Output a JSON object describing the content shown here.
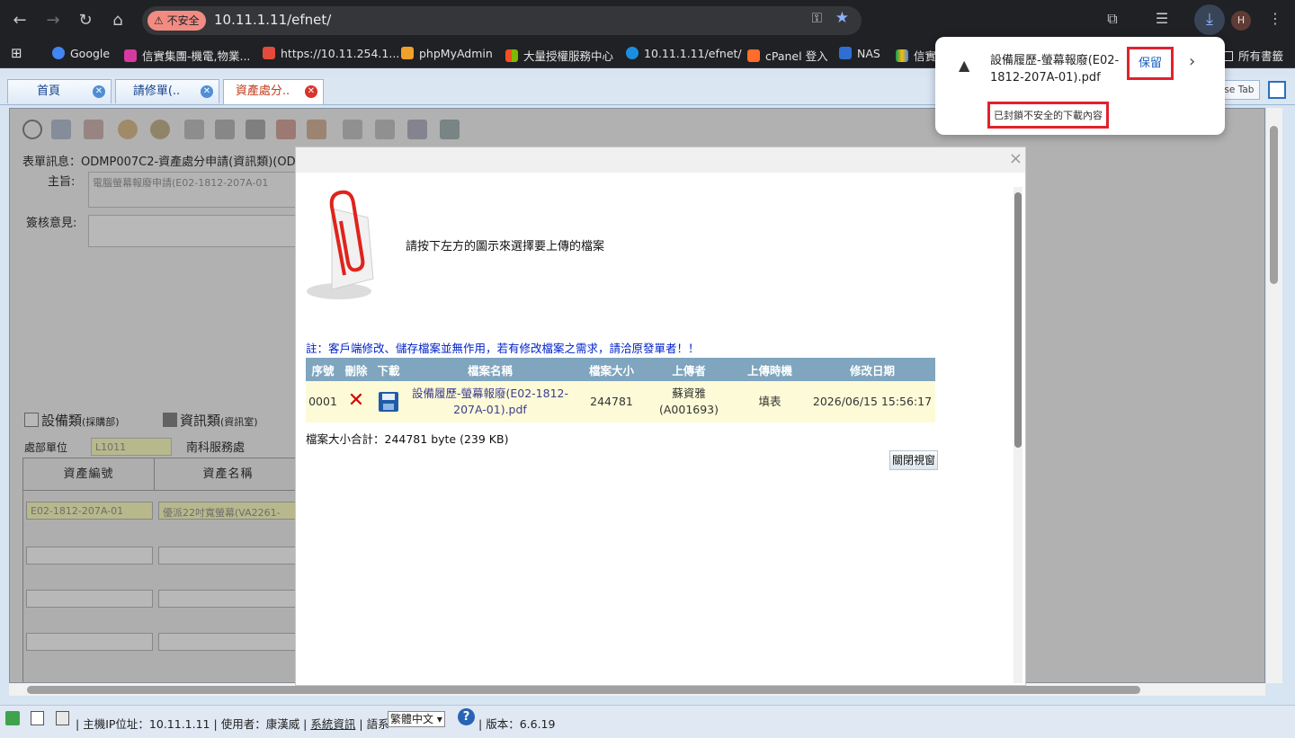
{
  "browser": {
    "insecure_label": "不安全",
    "url": "10.11.1.11/efnet/",
    "avatar_letter": "H",
    "bookmarks": [
      "Google",
      "信實集團-機電,物業...",
      "https://10.11.254.1...",
      "phpMyAdmin",
      "大量授權服務中心",
      "10.11.1.11/efnet/",
      "cPanel 登入",
      "NAS",
      "信實"
    ],
    "all_bookmarks": "所有書籤"
  },
  "download_popup": {
    "file_name": "設備履歷-螢幕報廢(E02-1812-207A-01).pdf",
    "status": "已封鎖不安全的下載內容",
    "keep_label": "保留"
  },
  "tabs": [
    {
      "label": "首頁",
      "active": false
    },
    {
      "label": "請修單(..",
      "active": false
    },
    {
      "label": "資產處分..",
      "active": true
    }
  ],
  "close_tab_label": "ose Tab",
  "form": {
    "info_label": "表單訊息：",
    "info_value": "ODMP007C2-資產處分申請(資訊類)(OD",
    "subject_label": "主旨:",
    "subject_value": "電腦螢幕報廢申請(E02-1812-207A-01",
    "review_label": "簽核意見:",
    "category_equipment": "設備類",
    "category_equipment_sub": "(採購部)",
    "category_it": "資訊類",
    "category_it_sub": "(資訊室)",
    "dept_label": "處部單位",
    "dept_code": "L1011",
    "dept_name": "南科服務處",
    "grid_headers": [
      "資產編號",
      "資產名稱"
    ],
    "grid_row1": [
      "E02-1812-207A-01",
      "優派22吋寬螢幕(VA2261-"
    ]
  },
  "dialog": {
    "prompt": "請按下左方的圖示來選擇要上傳的檔案",
    "note": "註：客戶端修改、儲存檔案並無作用，若有修改檔案之需求，請洽原發單者！！",
    "columns": [
      "序號",
      "刪除",
      "下載",
      "檔案名稱",
      "檔案大小",
      "上傳者",
      "上傳時機",
      "修改日期"
    ],
    "rows": [
      {
        "seq": "0001",
        "file_name": "設備履歷-螢幕報廢(E02-1812-207A-01).pdf",
        "size": "244781",
        "uploader": "蘇資雅(A001693)",
        "timing": "填表",
        "modified": "2026/06/15 15:56:17"
      }
    ],
    "total": "檔案大小合計：244781 byte (239 KB)",
    "close_button": "關閉視窗"
  },
  "status_bar": {
    "host_ip": "主機IP位址：10.11.1.11",
    "user": "使用者：康漢威",
    "sysinfo": "系統資訊",
    "lang_label": "語系",
    "lang_value": "繁體中文",
    "version": "版本：6.6.19"
  }
}
